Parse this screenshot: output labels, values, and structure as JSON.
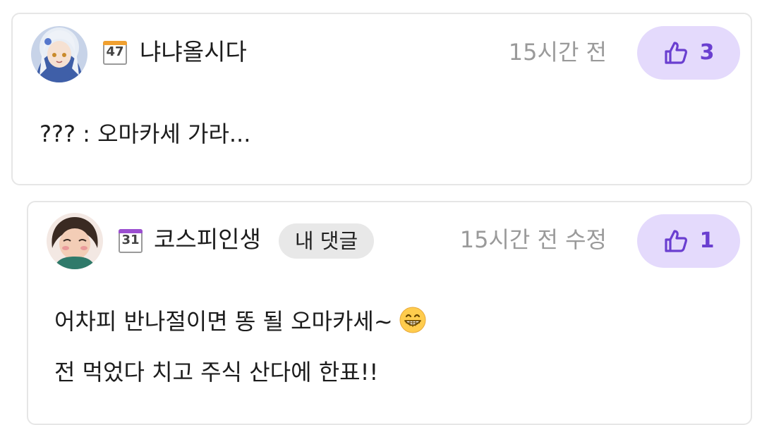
{
  "comments": [
    {
      "user": {
        "name": "냐냐올시다",
        "level": "47"
      },
      "time": "15시간 전",
      "likes": "3",
      "lines": [
        "??? : 오마카세 가라..."
      ]
    },
    {
      "user": {
        "name": "코스피인생",
        "level": "31"
      },
      "badge": "내 댓글",
      "time": "15시간 전 수정",
      "likes": "1",
      "lines": [
        "어차피 반나절이면 똥 될 오마카세~",
        "전 먹었다 치고 주식 산다에 한표!!"
      ],
      "emoji": "grinning-face-emoji"
    }
  ],
  "colors": {
    "like_bg": "#e4dafc",
    "like_fg": "#6a3fd0",
    "level47_accent": "#f0a030",
    "level31_accent": "#9b4fd0",
    "time_text": "#9a9a9a"
  }
}
